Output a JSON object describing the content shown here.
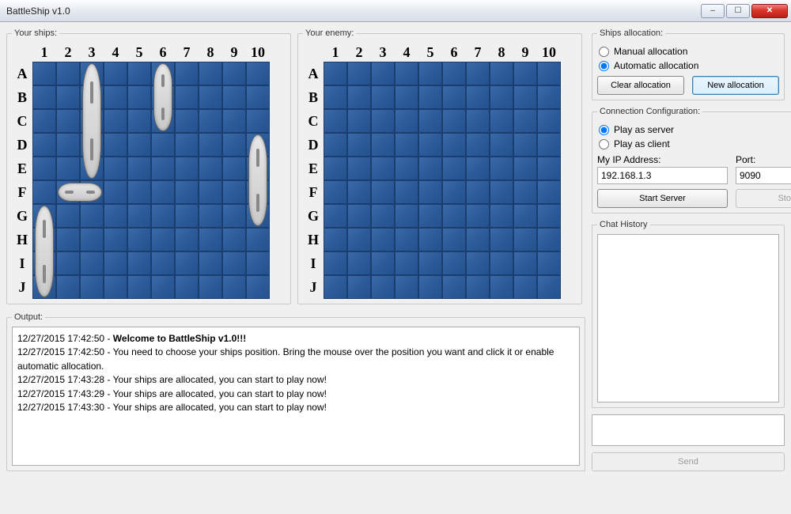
{
  "window": {
    "title": "BattleShip v1.0"
  },
  "grids": {
    "your_label": "Your ships:",
    "enemy_label": "Your enemy:",
    "cols": [
      "1",
      "2",
      "3",
      "4",
      "5",
      "6",
      "7",
      "8",
      "9",
      "10"
    ],
    "rows": [
      "A",
      "B",
      "C",
      "D",
      "E",
      "F",
      "G",
      "H",
      "I",
      "J"
    ]
  },
  "ships": [
    {
      "row": 0,
      "col": 2,
      "len": 5,
      "orient": "v"
    },
    {
      "row": 0,
      "col": 5,
      "len": 3,
      "orient": "v"
    },
    {
      "row": 3,
      "col": 9,
      "len": 4,
      "orient": "v"
    },
    {
      "row": 5,
      "col": 1,
      "len": 2,
      "orient": "h"
    },
    {
      "row": 6,
      "col": 0,
      "len": 4,
      "orient": "v"
    }
  ],
  "allocation": {
    "legend": "Ships allocation:",
    "manual": "Manual allocation",
    "automatic": "Automatic allocation",
    "selected": "automatic",
    "clear": "Clear allocation",
    "new": "New allocation"
  },
  "connection": {
    "legend": "Connection Configuration:",
    "server": "Play as server",
    "client": "Play as client",
    "selected": "server",
    "ip_label": "My IP Address:",
    "ip_value": "192.168.1.3",
    "port_label": "Port:",
    "port_value": "9090",
    "start": "Start Server",
    "stop": "Stop Server"
  },
  "chat": {
    "legend": "Chat History",
    "send": "Send"
  },
  "output": {
    "legend": "Output:",
    "lines": [
      {
        "ts": "12/27/2015 17:42:50",
        "text": "Welcome to BattleShip v1.0!!!",
        "bold": true
      },
      {
        "ts": "12/27/2015 17:42:50",
        "text": "You need to choose your ships position. Bring the mouse over the position you want and click it or enable automatic allocation.",
        "bold": false
      },
      {
        "ts": "12/27/2015 17:43:28",
        "text": "Your ships are allocated, you can start to play now!",
        "bold": false
      },
      {
        "ts": "12/27/2015 17:43:29",
        "text": "Your ships are allocated, you can start to play now!",
        "bold": false
      },
      {
        "ts": "12/27/2015 17:43:30",
        "text": "Your ships are allocated, you can start to play now!",
        "bold": false
      }
    ]
  }
}
